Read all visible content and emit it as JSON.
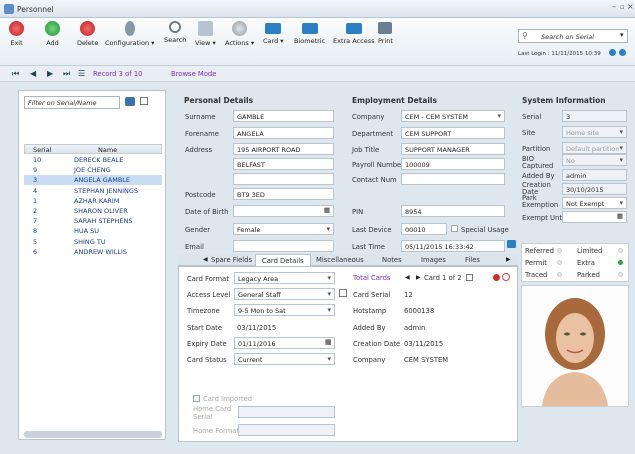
{
  "window": {
    "title": "Personnel"
  },
  "ribbon": {
    "items": [
      "Exit",
      "Add",
      "Delete",
      "Configuration",
      "Search",
      "View",
      "Actions",
      "Card",
      "Biometric",
      "Extra Access",
      "Print"
    ],
    "search_placeholder": "Search on Serial",
    "last_login": "Last Login : 11/11/2015 10:39"
  },
  "nav": {
    "record": "Record 3 of 10",
    "mode": "Browse Mode"
  },
  "list": {
    "filter": "Filter on Serial/Name",
    "headers": [
      "Serial",
      "Name"
    ],
    "rows": [
      [
        "10",
        "DERECK BEALE"
      ],
      [
        "9",
        "JOE CHENG"
      ],
      [
        "3",
        "ANGELA GAMBLE"
      ],
      [
        "4",
        "STEPHAN JENNINGS"
      ],
      [
        "1",
        "AZHAR KARIM"
      ],
      [
        "2",
        "SHARON OLIVER"
      ],
      [
        "7",
        "SARAH STEPHENS"
      ],
      [
        "8",
        "HUA SU"
      ],
      [
        "5",
        "SHING TU"
      ],
      [
        "6",
        "ANDREW WILLIS"
      ]
    ]
  },
  "personal": {
    "title": "Personal Details",
    "surname_l": "Surname",
    "surname": "GAMBLE",
    "forename_l": "Forename",
    "forename": "ANGELA",
    "address_l": "Address",
    "address1": "195 AIRPORT ROAD",
    "address2": "BELFAST",
    "postcode_l": "Postcode",
    "postcode": "BT9 3ED",
    "dob_l": "Date of Birth",
    "gender_l": "Gender",
    "gender": "Female",
    "email_l": "Email"
  },
  "employment": {
    "title": "Employment Details",
    "company_l": "Company",
    "company": "CEM   - CEM SYSTEM",
    "department_l": "Department",
    "department": "CEM SUPPORT",
    "jobtitle_l": "Job Title",
    "jobtitle": "SUPPORT MANAGER",
    "payroll_l": "Payroll Number",
    "payroll": "100009",
    "contact_l": "Contact Num",
    "pin_l": "PIN",
    "pin": "8954",
    "lastdevice_l": "Last Device",
    "lastdevice": "00010",
    "special_l": "Special Usage",
    "lasttime_l": "Last Time",
    "lasttime": "05/11/2015 16:33:42"
  },
  "system": {
    "title": "System Information",
    "serial_l": "Serial",
    "serial": "3",
    "site_l": "Site",
    "site": "Home site",
    "partition_l": "Partition",
    "partition": "Default partition",
    "bio_l": "BIO Captured",
    "bio": "No",
    "addedby_l": "Added By",
    "addedby": "admin",
    "creation_l": "Creation Date",
    "creation": "30/10/2015",
    "park_l": "Park Exemption",
    "park": "Not Exempt",
    "exempt_l": "Exempt Until"
  },
  "status": {
    "referred": "Referred",
    "limited": "Limited",
    "permit": "Permit",
    "extra": "Extra",
    "traced": "Traced",
    "parked": "Parked"
  },
  "tabs": [
    "Spare Fields",
    "Card Details",
    "Miscellaneous",
    "Notes",
    "Images",
    "Files"
  ],
  "card": {
    "format_l": "Card Format",
    "format": "Legacy Area",
    "access_l": "Access Level",
    "access": "General Staff",
    "tz_l": "Timezone",
    "tz": "9-5 Mon to Sat",
    "start_l": "Start Date",
    "start": "03/11/2015",
    "expiry_l": "Expiry Date",
    "expiry": "01/11/2016",
    "status_l": "Card Status",
    "status": "Current",
    "total_l": "Total Cards",
    "total": "Card 1 of 2",
    "cserial_l": "Card Serial",
    "cserial": "12",
    "hot_l": "Hotstamp",
    "hot": "6000138",
    "added_l": "Added By",
    "added": "admin",
    "cdate_l": "Creation Date",
    "cdate": "03/11/2015",
    "company_l": "Company",
    "company": "CEM SYSTEM",
    "imported_l": "Card Imported",
    "homeserial_l": "Home Card Serial",
    "homeformat_l": "Home Format"
  },
  "colors": {
    "accent": "#1a3c8c",
    "purple": "#7b2fbf",
    "green": "#35b04a"
  }
}
